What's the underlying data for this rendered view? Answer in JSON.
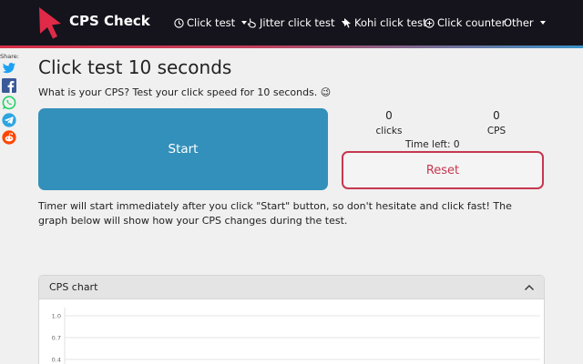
{
  "header": {
    "brand": "CPS Check",
    "nav": [
      {
        "label": "Click test",
        "icon": "clock-icon",
        "dropdown": true
      },
      {
        "label": "Jitter click test",
        "icon": "hand-pointer-icon",
        "dropdown": true
      },
      {
        "label": "Kohi click test",
        "icon": "cursor-icon",
        "dropdown": false
      },
      {
        "label": "Click counter",
        "icon": "plus-circle-icon",
        "dropdown": false
      },
      {
        "label": "Other",
        "icon": "",
        "dropdown": true
      }
    ]
  },
  "share": {
    "label": "Share:",
    "icons": [
      "twitter-icon",
      "facebook-icon",
      "whatsapp-icon",
      "telegram-icon",
      "reddit-icon"
    ]
  },
  "main": {
    "title": "Click test 10 seconds",
    "subtitle": "What is your CPS? Test your click speed for 10 seconds. 😉",
    "start_label": "Start",
    "clicks_value": "0",
    "clicks_label": "clicks",
    "cps_value": "0",
    "cps_label": "CPS",
    "time_left": "Time left: 0",
    "reset_label": "Reset",
    "description": "Timer will start immediately after you click \"Start\" button, so don't hesitate and click fast! The graph below will show how your CPS changes during the test."
  },
  "chart": {
    "title": "CPS chart"
  },
  "chart_data": {
    "type": "line",
    "title": "",
    "xlabel": "",
    "ylabel": "",
    "ylim": [
      0,
      1
    ],
    "yticks": [
      "1.0",
      "0.7",
      "0.4"
    ],
    "series": [],
    "grid": true
  },
  "colors": {
    "navbar": "#15141c",
    "start_button": "#3390ba",
    "reset": "#c7374f"
  }
}
